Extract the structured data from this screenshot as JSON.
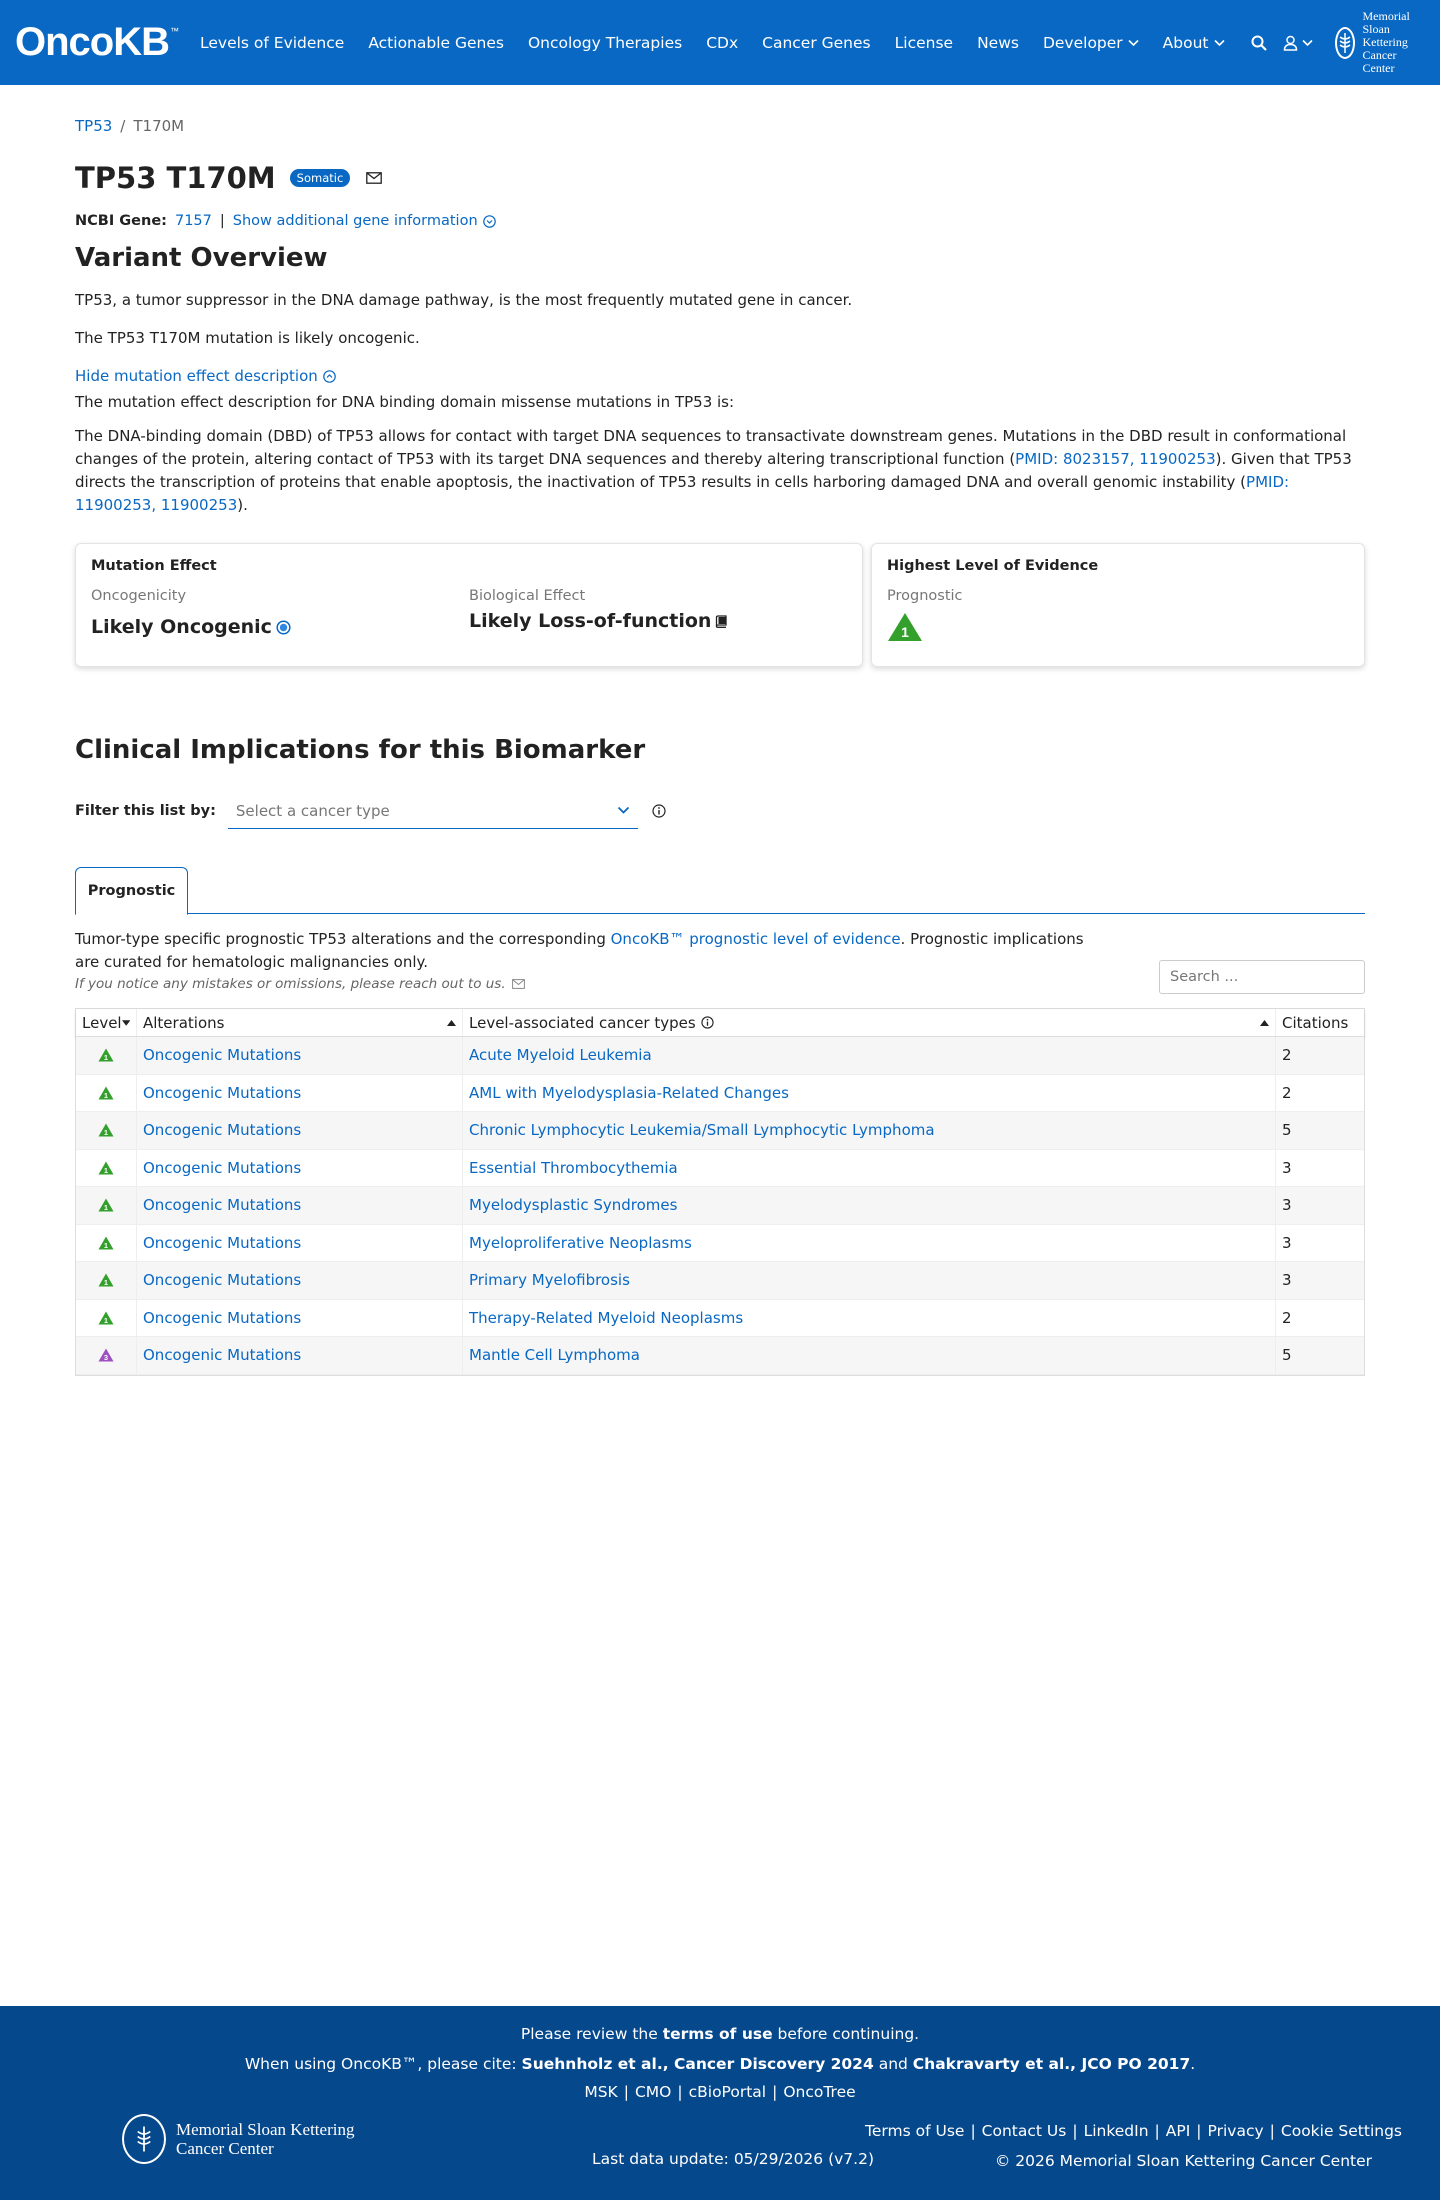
{
  "nav": {
    "brand": "OncoKB",
    "brand_tm": "™",
    "items": [
      "Levels of Evidence",
      "Actionable Genes",
      "Oncology Therapies",
      "CDx",
      "Cancer Genes",
      "License",
      "News",
      "Developer",
      "About"
    ],
    "msk_line1": "Memorial Sloan Kettering",
    "msk_line2": "Cancer Center"
  },
  "breadcrumb": {
    "gene": "TP53",
    "sep": "/",
    "variant": "T170M"
  },
  "title": "TP53 T170M",
  "badge": "Somatic",
  "gene_info": {
    "label": "NCBI Gene:",
    "id": "7157",
    "sep": "|",
    "toggle": "Show additional gene information"
  },
  "overview": {
    "title": "Variant Overview",
    "p1": "TP53, a tumor suppressor in the DNA damage pathway, is the most frequently mutated gene in cancer.",
    "p2": "The TP53 T170M mutation is likely oncogenic.",
    "toggle": "Hide mutation effect description",
    "intro": "The mutation effect description for DNA binding domain missense mutations in TP53 is:",
    "body_a": "The DNA-binding domain (DBD) of TP53 allows for contact with target DNA sequences to transactivate downstream genes. Mutations in the DBD result in conformational changes of the protein, altering contact of TP53 with its target DNA sequences and thereby altering transcriptional function (",
    "body_link1": "PMID: 8023157, 11900253",
    "body_b": "). Given that TP53 directs the transcription of proteins that enable apoptosis, the inactivation of TP53 results in cells harboring damaged DNA and overall genomic instability (",
    "body_link2": "PMID: 11900253, 11900253",
    "body_c": ")."
  },
  "mutation_effect": {
    "title": "Mutation Effect",
    "onc_label": "Oncogenicity",
    "onc_value": "Likely Oncogenic",
    "bio_label": "Biological Effect",
    "bio_value": "Likely Loss-of-function"
  },
  "highest_level": {
    "title": "Highest Level of Evidence",
    "label": "Prognostic",
    "level": "1"
  },
  "clinical": {
    "title": "Clinical Implications for this Biomarker",
    "filter_label": "Filter this list by:",
    "filter_placeholder": "Select a cancer type",
    "tab": "Prognostic",
    "desc_a": "Tumor-type specific prognostic TP53 alterations and the corresponding ",
    "desc_link": "OncoKB™ prognostic level of evidence",
    "desc_b": ". Prognostic implications are curated for hematologic malignancies only.",
    "note": "If you notice any mistakes or omissions, please reach out to us.",
    "search_placeholder": "Search ..."
  },
  "table": {
    "headers": [
      "Level",
      "Alterations",
      "Level-associated cancer types",
      "Citations"
    ],
    "rows": [
      {
        "level": "1",
        "alteration": "Oncogenic Mutations",
        "cancer": "Acute Myeloid Leukemia",
        "citations": "2"
      },
      {
        "level": "1",
        "alteration": "Oncogenic Mutations",
        "cancer": "AML with Myelodysplasia-Related Changes",
        "citations": "2"
      },
      {
        "level": "1",
        "alteration": "Oncogenic Mutations",
        "cancer": "Chronic Lymphocytic Leukemia/Small Lymphocytic Lymphoma",
        "citations": "5"
      },
      {
        "level": "1",
        "alteration": "Oncogenic Mutations",
        "cancer": "Essential Thrombocythemia",
        "citations": "3"
      },
      {
        "level": "1",
        "alteration": "Oncogenic Mutations",
        "cancer": "Myelodysplastic Syndromes",
        "citations": "3"
      },
      {
        "level": "1",
        "alteration": "Oncogenic Mutations",
        "cancer": "Myeloproliferative Neoplasms",
        "citations": "3"
      },
      {
        "level": "1",
        "alteration": "Oncogenic Mutations",
        "cancer": "Primary Myelofibrosis",
        "citations": "3"
      },
      {
        "level": "1",
        "alteration": "Oncogenic Mutations",
        "cancer": "Therapy-Related Myeloid Neoplasms",
        "citations": "2"
      },
      {
        "level": "3",
        "alteration": "Oncogenic Mutations",
        "cancer": "Mantle Cell Lymphoma",
        "citations": "5"
      }
    ]
  },
  "footer": {
    "review_a": "Please review the ",
    "review_b": "terms of use",
    "review_c": " before continuing.",
    "cite_a": "When using OncoKB™, please cite: ",
    "cite_b": "Suehnholz et al., Cancer Discovery 2024",
    "cite_c": " and ",
    "cite_d": "Chakravarty et al., JCO PO 2017",
    "cite_e": ".",
    "partners": [
      "MSK",
      "CMO",
      "cBioPortal",
      "OncoTree"
    ],
    "msk_line1": "Memorial Sloan Kettering",
    "msk_line2": "Cancer Center",
    "last_update": "Last data update: 05/29/2026 (v7.2)",
    "links": [
      "Terms of Use",
      "Contact Us",
      "LinkedIn",
      "API",
      "Privacy",
      "Cookie Settings"
    ],
    "copyright": "© 2026 Memorial Sloan Kettering Cancer Center"
  },
  "colors": {
    "brand": "#0968c3",
    "footer": "#06488c",
    "level1": "#33a02c",
    "level3": "#9e4fc1"
  }
}
